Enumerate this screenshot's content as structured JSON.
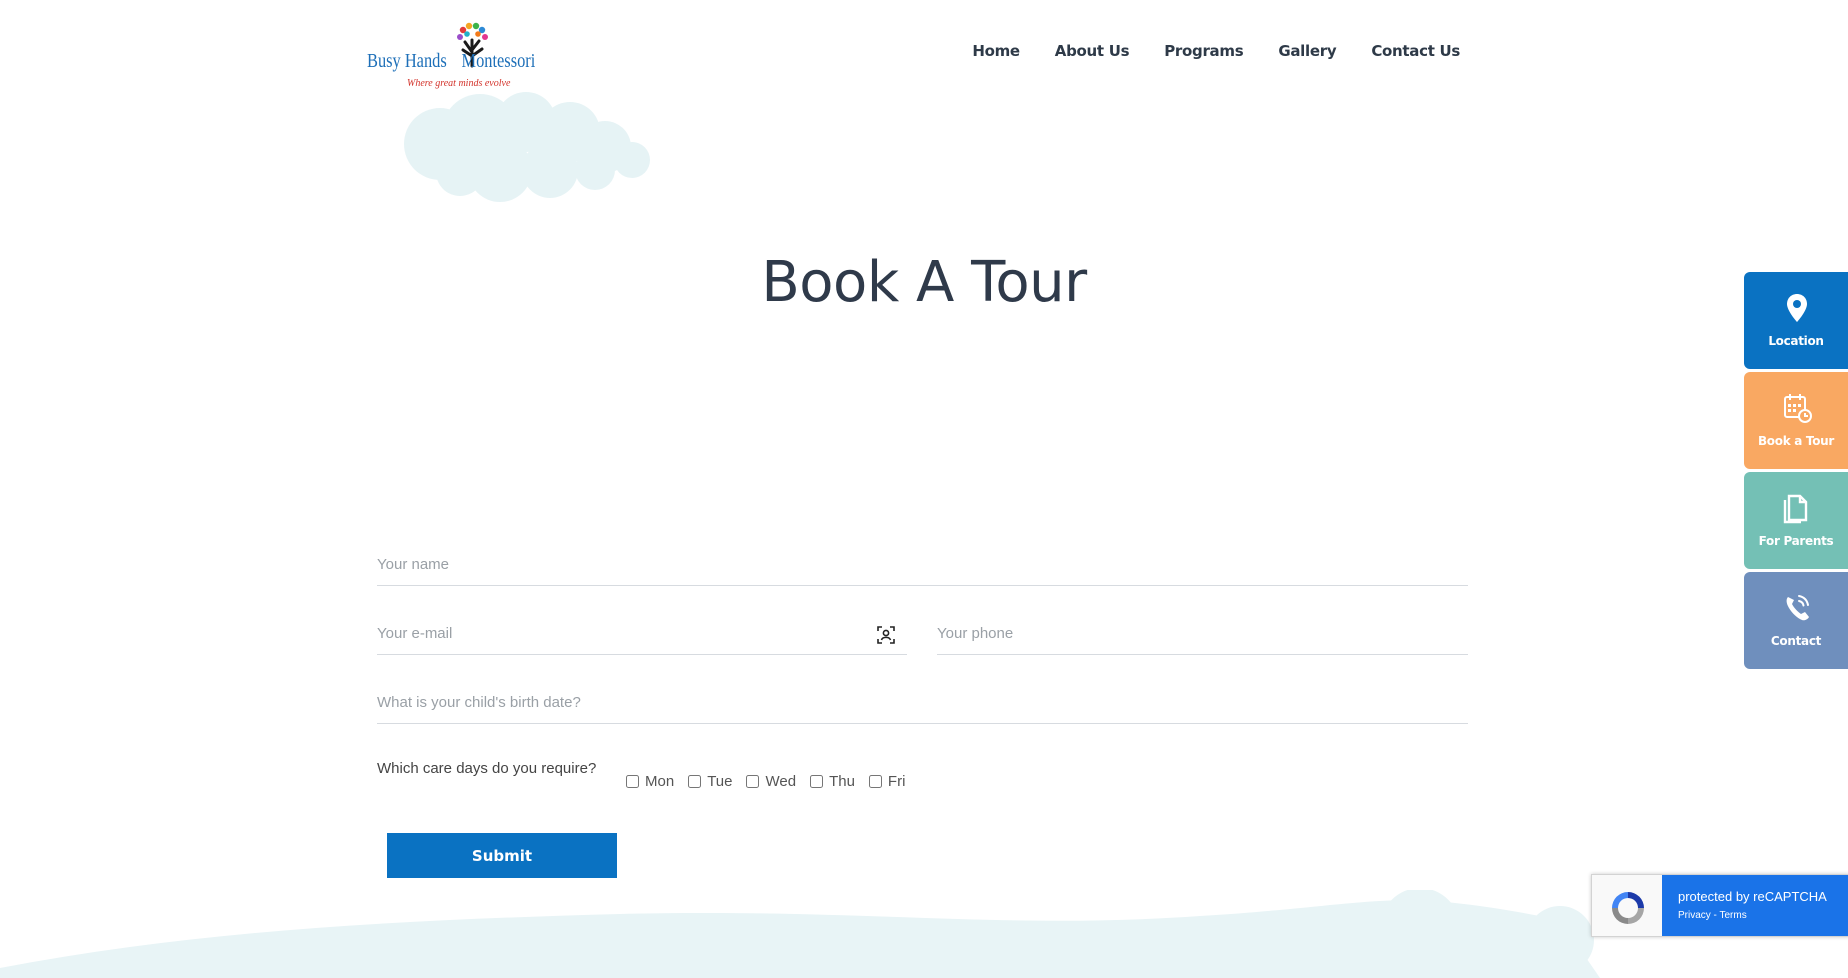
{
  "header": {
    "logo": {
      "brand_part1": "Busy Hands",
      "brand_part2": "Montessori",
      "tagline": "Where great minds evolve"
    },
    "nav": [
      "Home",
      "About Us",
      "Programs",
      "Gallery",
      "Contact Us"
    ]
  },
  "page_title": "Book A Tour",
  "form": {
    "name_placeholder": "Your name",
    "email_placeholder": "Your e-mail",
    "phone_placeholder": "Your phone",
    "birth_placeholder": "What is your child's birth date?",
    "care_days_label": "Which care days do you require?",
    "days": [
      "Mon",
      "Tue",
      "Wed",
      "Thu",
      "Fri"
    ],
    "submit_label": "Submit"
  },
  "side_buttons": [
    {
      "label": "Location",
      "icon": "location-pin-icon",
      "color": "#0a72c2"
    },
    {
      "label": "Book a Tour",
      "icon": "calendar-clock-icon",
      "color": "#f9a862"
    },
    {
      "label": "For Parents",
      "icon": "documents-icon",
      "color": "#74c0b5"
    },
    {
      "label": "Contact",
      "icon": "phone-icon",
      "color": "#6f8fbd"
    }
  ],
  "recaptcha": {
    "line1": "protected by reCAPTCHA",
    "line2": "Privacy - Terms"
  }
}
